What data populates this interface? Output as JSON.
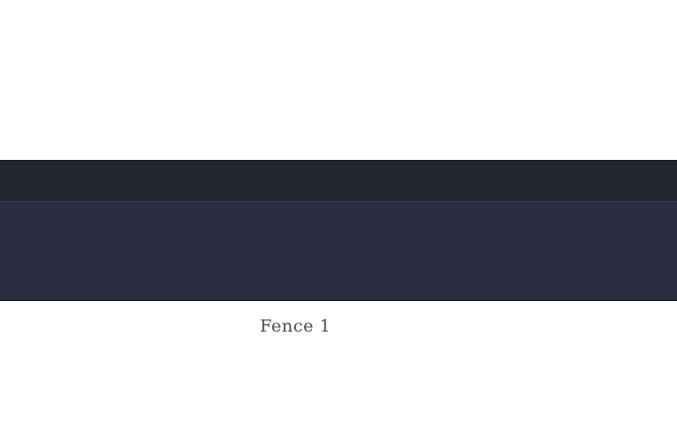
{
  "fence": {
    "label": "Fence 1"
  },
  "colors": {
    "background": "#ffffff",
    "header": "#22252f",
    "body": "#2a2d3f",
    "label_text": "#4a4a4a"
  }
}
